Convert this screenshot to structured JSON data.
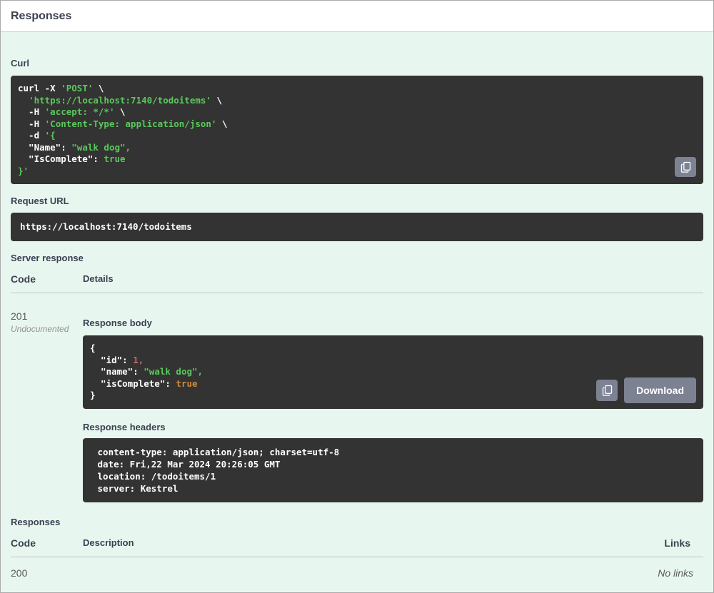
{
  "colors": {
    "accent_bg": "#e8f6f0",
    "code_bg": "#333333",
    "tok_string": "#5bc85b",
    "tok_number": "#d36363",
    "tok_literal": "#cc8b3f",
    "button_bg": "#7d8293"
  },
  "header": {
    "title": "Responses"
  },
  "curl_section": {
    "label": "Curl",
    "code": [
      [
        {
          "t": "curl -X ",
          "c": "plain"
        },
        {
          "t": "'POST'",
          "c": "string"
        },
        {
          "t": " \\",
          "c": "plain"
        }
      ],
      [
        {
          "t": "  ",
          "c": "plain"
        },
        {
          "t": "'https://localhost:7140/todoitems'",
          "c": "string"
        },
        {
          "t": " \\",
          "c": "plain"
        }
      ],
      [
        {
          "t": "  -H ",
          "c": "plain"
        },
        {
          "t": "'accept: */*'",
          "c": "string"
        },
        {
          "t": " \\",
          "c": "plain"
        }
      ],
      [
        {
          "t": "  -H ",
          "c": "plain"
        },
        {
          "t": "'Content-Type: application/json'",
          "c": "string"
        },
        {
          "t": " \\",
          "c": "plain"
        }
      ],
      [
        {
          "t": "  -d ",
          "c": "plain"
        },
        {
          "t": "'{",
          "c": "string"
        }
      ],
      [
        {
          "t": "  \"Name\": ",
          "c": "plain"
        },
        {
          "t": "\"walk dog\",",
          "c": "string"
        }
      ],
      [
        {
          "t": "  \"IsComplete\": ",
          "c": "plain"
        },
        {
          "t": "true",
          "c": "string"
        }
      ],
      [
        {
          "t": "}'",
          "c": "string"
        }
      ]
    ]
  },
  "request_url": {
    "label": "Request URL",
    "value": "https://localhost:7140/todoitems"
  },
  "server_response": {
    "label": "Server response",
    "columns": {
      "code": "Code",
      "details": "Details"
    },
    "row": {
      "code": "201",
      "code_note": "Undocumented",
      "response_body": {
        "label": "Response body",
        "download_label": "Download",
        "code": [
          [
            {
              "t": "{",
              "c": "plain"
            }
          ],
          [
            {
              "t": "  \"id\": ",
              "c": "plain"
            },
            {
              "t": "1,",
              "c": "number"
            }
          ],
          [
            {
              "t": "  \"name\": ",
              "c": "plain"
            },
            {
              "t": "\"walk dog\",",
              "c": "string"
            }
          ],
          [
            {
              "t": "  \"isComplete\": ",
              "c": "plain"
            },
            {
              "t": "true",
              "c": "literal"
            }
          ],
          [
            {
              "t": "}",
              "c": "plain"
            }
          ]
        ]
      },
      "response_headers": {
        "label": "Response headers",
        "lines": [
          " content-type: application/json; charset=utf-8 ",
          " date: Fri,22 Mar 2024 20:26:05 GMT ",
          " location: /todoitems/1 ",
          " server: Kestrel "
        ]
      }
    }
  },
  "responses_section": {
    "label": "Responses",
    "columns": {
      "code": "Code",
      "description": "Description",
      "links": "Links"
    },
    "rows": [
      {
        "code": "200",
        "description": "",
        "links": "No links"
      }
    ]
  }
}
